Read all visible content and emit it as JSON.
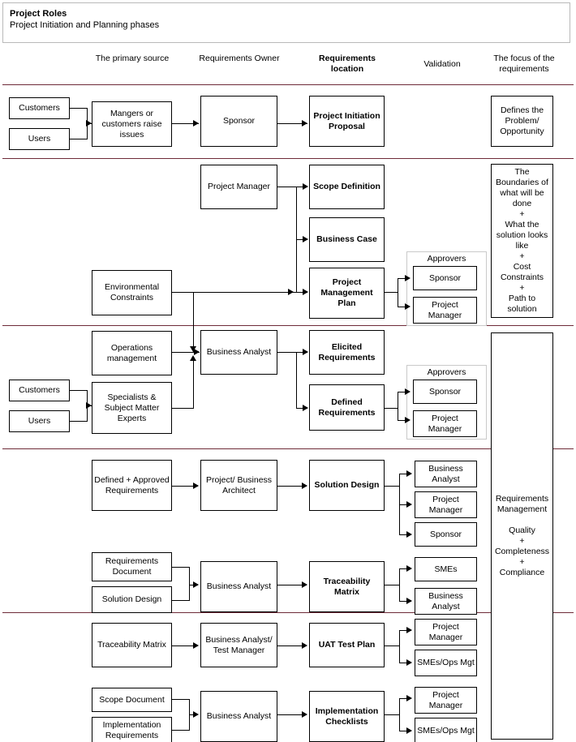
{
  "header": {
    "title": "Project Roles",
    "subtitle": "Project Initiation and Planning phases"
  },
  "columns": [
    {
      "id": "primary-source",
      "label": "The primary\nsource",
      "bold": false
    },
    {
      "id": "requirements-owner",
      "label": "Requirements\nOwner",
      "bold": false
    },
    {
      "id": "requirements-location",
      "label": "Requirements\nlocation",
      "bold": true
    },
    {
      "id": "validation",
      "label": "Validation",
      "bold": false
    },
    {
      "id": "focus-of-requirements",
      "label": "The focus of the\nrequirements",
      "bold": false
    }
  ],
  "group_labels": {
    "approvers_1": "Approvers",
    "approvers_2": "Approvers"
  },
  "rows": [
    {
      "id": "row-initiation",
      "sources": [
        "Customers",
        "Users"
      ],
      "owner_stage": "Mangers or customers raise issues",
      "owner": "Sponsor",
      "location": "Project Initiation Proposal",
      "validation": [],
      "focus": "Defines the Problem/ Opportunity"
    },
    {
      "id": "row-planning",
      "sources": [
        "Environmental Constraints"
      ],
      "owner": "Project Manager",
      "locations": [
        "Scope Definition",
        "Business Case",
        "Project Management Plan"
      ],
      "validation": [
        "Sponsor",
        "Project Manager"
      ],
      "focus": "The Boundaries of what will be done\n+\nWhat the solution looks like\n+\nCost Constraints\n+\nPath to solution"
    },
    {
      "id": "row-requirements",
      "sources": [
        "Operations management",
        "Specialists & Subject Matter Experts",
        "Customers",
        "Users"
      ],
      "owner": "Business Analyst",
      "locations": [
        "Elicited Requirements",
        "Defined Requirements"
      ],
      "validation": [
        "Sponsor",
        "Project Manager"
      ]
    },
    {
      "id": "row-design",
      "sources": [
        "Defined + Approved Requirements",
        "Requirements Document",
        "Solution Design"
      ],
      "owners": [
        "Project/ Business Architect",
        "Business Analyst"
      ],
      "locations": [
        "Solution Design",
        "Traceability Matrix"
      ],
      "validation": [
        "Business Analyst",
        "Project Manager",
        "Sponsor",
        "SMEs",
        "Business Analyst"
      ]
    },
    {
      "id": "row-implementation",
      "sources": [
        "Traceability Matrix",
        "Scope Document",
        "Implementation Requirements"
      ],
      "owners": [
        "Business Analyst/ Test Manager",
        "Business Analyst"
      ],
      "locations": [
        "UAT Test Plan",
        "Implementation Checklists"
      ],
      "validation": [
        "Project Manager",
        "SMEs/Ops Mgt",
        "Project Manager",
        "SMEs/Ops Mgt"
      ]
    }
  ],
  "boxes": {
    "r1_customers": "Customers",
    "r1_users": "Users",
    "r1_stage": "Mangers or customers raise issues",
    "r1_owner": "Sponsor",
    "r1_location": "Project Initiation Proposal",
    "r1_focus": "Defines the Problem/ Opportunity",
    "r2_owner": "Project Manager",
    "r2_loc1": "Scope Definition",
    "r2_loc2": "Business Case",
    "r2_loc3": "Project Management Plan",
    "r2_src": "Environmental Constraints",
    "r2_val1": "Sponsor",
    "r2_val2": "Project Manager",
    "r2_focus": "The Boundaries of what will be done\n+\nWhat the solution looks like\n+\nCost Constraints\n+\nPath to solution",
    "r3_src1": "Operations management",
    "r3_src2": "Specialists & Subject Matter Experts",
    "r3_customers": "Customers",
    "r3_users": "Users",
    "r3_owner": "Business Analyst",
    "r3_loc1": "Elicited Requirements",
    "r3_loc2": "Defined Requirements",
    "r3_val1": "Sponsor",
    "r3_val2": "Project Manager",
    "r4_src1": "Defined + Approved Requirements",
    "r4_owner1": "Project/ Business Architect",
    "r4_loc1": "Solution Design",
    "r4_val1": "Business Analyst",
    "r4_val2": "Project Manager",
    "r4_val3": "Sponsor",
    "r4_src2a": "Requirements Document",
    "r4_src2b": "Solution Design",
    "r4_owner2": "Business Analyst",
    "r4_loc2": "Traceability Matrix",
    "r4_val4": "SMEs",
    "r4_val5": "Business Analyst",
    "r5_src1": "Traceability Matrix",
    "r5_owner1": "Business Analyst/ Test Manager",
    "r5_loc1": "UAT Test Plan",
    "r5_val1": "Project Manager",
    "r5_val2": "SMEs/Ops Mgt",
    "r5_src2a": "Scope Document",
    "r5_src2b": "Implementation Requirements",
    "r5_owner2": "Business Analyst",
    "r5_loc2": "Implementation Checklists",
    "r5_val3": "Project Manager",
    "r5_val4": "SMEs/Ops Mgt",
    "req_mgmt": "Requirements Management\n\nQuality\n+\nCompleteness\n+\nCompliance"
  },
  "colors": {
    "divider": "#6e2b38",
    "box_border": "#000000",
    "group_border": "#c9c9c9",
    "text": "#000000",
    "background": "#ffffff"
  }
}
